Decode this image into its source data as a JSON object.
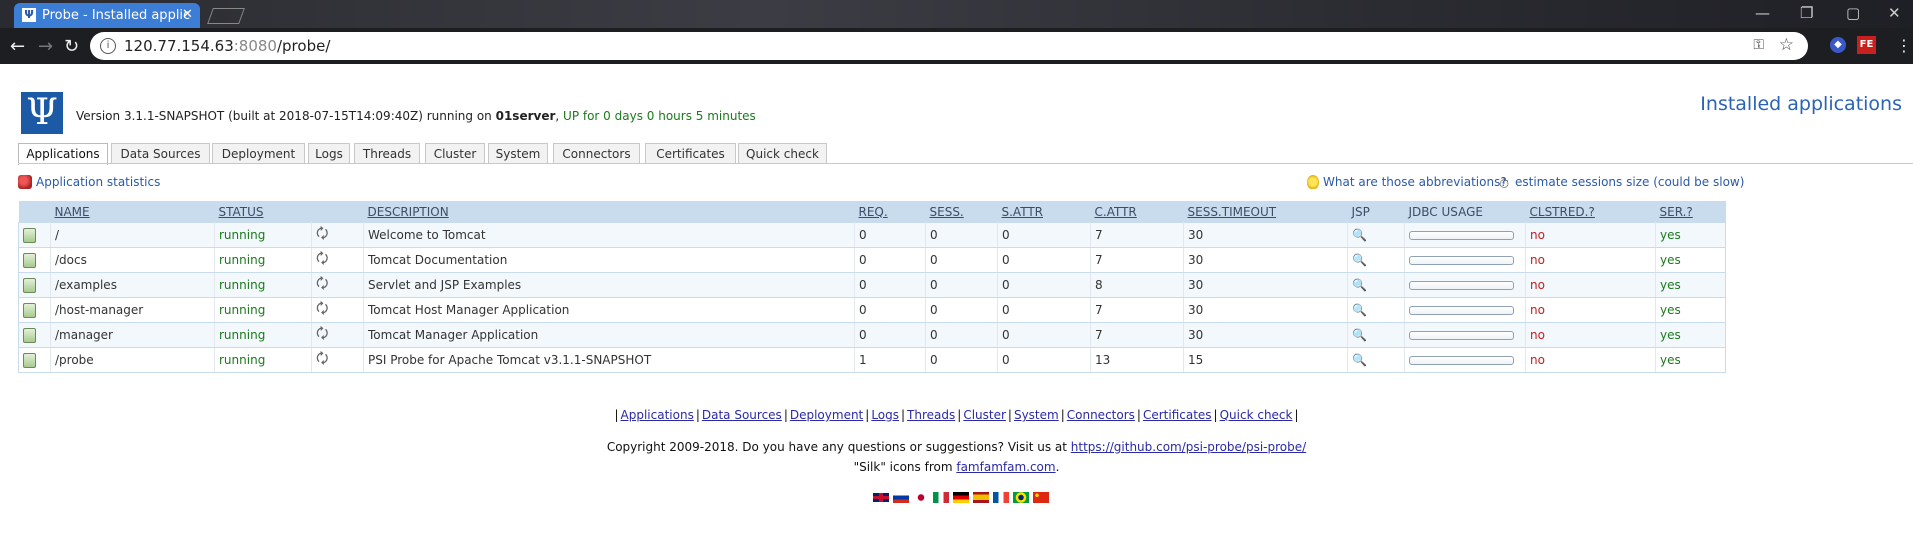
{
  "browser": {
    "tab_title": "Probe - Installed applic",
    "url_host": "120.77.154.63",
    "url_port": ":8080",
    "url_path": "/probe/"
  },
  "header": {
    "version_text": "Version 3.1.1-SNAPSHOT (built at 2018-07-15T14:09:40Z) running on ",
    "server": "01server",
    "uptime": "UP for 0 days 0 hours 5 minutes",
    "page_title": "Installed applications"
  },
  "tabs": [
    "Applications",
    "Data Sources",
    "Deployment",
    "Logs",
    "Threads",
    "Cluster",
    "System",
    "Connectors",
    "Certificates",
    "Quick check"
  ],
  "links": {
    "app_stats": "Application statistics",
    "abbreviations": "What are those abbreviations?",
    "estimate": "estimate sessions size (could be slow)"
  },
  "table": {
    "headers": [
      "NAME",
      "STATUS",
      "DESCRIPTION",
      "REQ.",
      "SESS.",
      "S.ATTR",
      "C.ATTR",
      "SESS.TIMEOUT",
      "JSP",
      "JDBC USAGE",
      "CLSTRED.?",
      "SER.?"
    ],
    "rows": [
      {
        "name": "/",
        "status": "running",
        "description": "Welcome to Tomcat",
        "req": "0",
        "sess": "0",
        "sattr": "0",
        "cattr": "7",
        "timeout": "30",
        "clustered": "no",
        "ser": "yes"
      },
      {
        "name": "/docs",
        "status": "running",
        "description": "Tomcat Documentation",
        "req": "0",
        "sess": "0",
        "sattr": "0",
        "cattr": "7",
        "timeout": "30",
        "clustered": "no",
        "ser": "yes"
      },
      {
        "name": "/examples",
        "status": "running",
        "description": "Servlet and JSP Examples",
        "req": "0",
        "sess": "0",
        "sattr": "0",
        "cattr": "8",
        "timeout": "30",
        "clustered": "no",
        "ser": "yes"
      },
      {
        "name": "/host-manager",
        "status": "running",
        "description": "Tomcat Host Manager Application",
        "req": "0",
        "sess": "0",
        "sattr": "0",
        "cattr": "7",
        "timeout": "30",
        "clustered": "no",
        "ser": "yes"
      },
      {
        "name": "/manager",
        "status": "running",
        "description": "Tomcat Manager Application",
        "req": "0",
        "sess": "0",
        "sattr": "0",
        "cattr": "7",
        "timeout": "30",
        "clustered": "no",
        "ser": "yes"
      },
      {
        "name": "/probe",
        "status": "running",
        "description": "PSI Probe for Apache Tomcat v3.1.1-SNAPSHOT",
        "req": "1",
        "sess": "0",
        "sattr": "0",
        "cattr": "13",
        "timeout": "15",
        "clustered": "no",
        "ser": "yes"
      }
    ]
  },
  "footer": {
    "nav": [
      "Applications",
      "Data Sources",
      "Deployment",
      "Logs",
      "Threads",
      "Cluster",
      "System",
      "Connectors",
      "Certificates",
      "Quick check"
    ],
    "copyright": "Copyright 2009-2018. Do you have any questions or suggestions? Visit us at ",
    "github": "https://github.com/psi-probe/psi-probe/",
    "silk_prefix": "\"Silk\" icons from ",
    "famfam": "famfamfam.com",
    "silk_suffix": "."
  },
  "flags": [
    "en",
    "ru",
    "ja",
    "it",
    "de",
    "es",
    "fr",
    "pt-br",
    "zh"
  ]
}
